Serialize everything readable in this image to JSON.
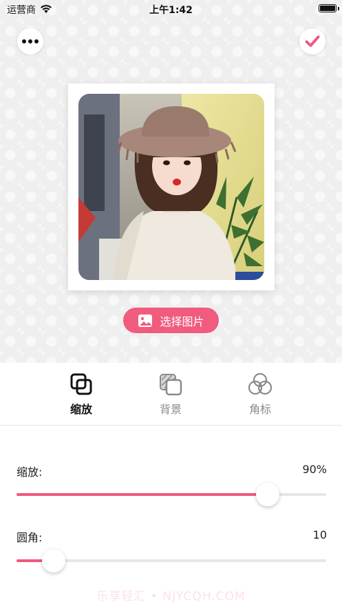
{
  "status_bar": {
    "carrier": "运营商",
    "time": "上午1:42"
  },
  "toolbar": {
    "more_icon": "more-dots-icon",
    "confirm_icon": "checkmark-icon",
    "accent_color": "#f15b7e"
  },
  "editor": {
    "choose_image_label": "选择图片",
    "choose_image_icon": "image-icon"
  },
  "tabs": [
    {
      "label": "缩放",
      "icon": "resize-icon",
      "active": true
    },
    {
      "label": "背景",
      "icon": "background-layers-icon",
      "active": false
    },
    {
      "label": "角标",
      "icon": "badge-circles-icon",
      "active": false
    }
  ],
  "controls": {
    "scale": {
      "label": "缩放:",
      "value_text": "90%",
      "level": 0.81
    },
    "corner": {
      "label": "圆角:",
      "value_text": "10",
      "level": 0.12
    }
  },
  "watermark": "乐享轻汇 • NJYCQH.COM"
}
